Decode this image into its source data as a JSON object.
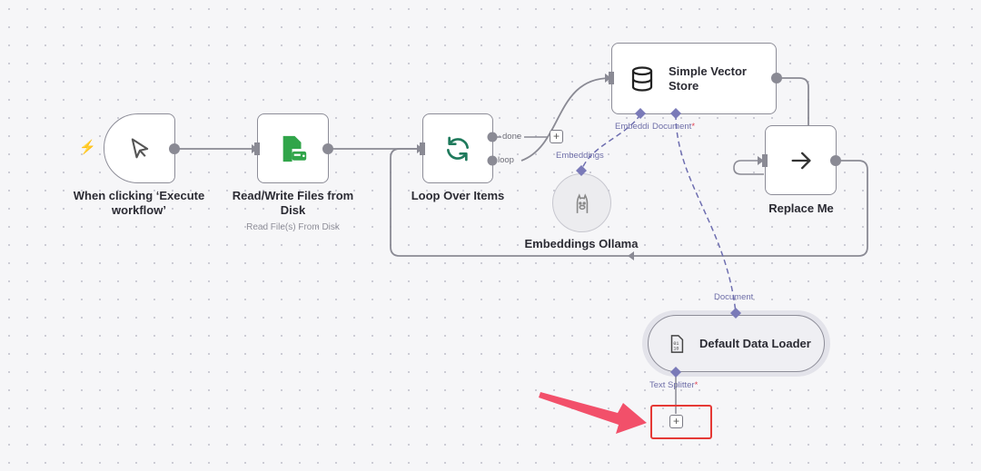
{
  "nodes": {
    "trigger": {
      "label": "When clicking ‘Execute workflow’",
      "icon": "cursor-icon"
    },
    "read_write": {
      "label": "Read/Write Files from Disk",
      "subtitle": "Read File(s) From Disk",
      "icon": "file-disk-icon"
    },
    "loop": {
      "label": "Loop Over Items",
      "icon": "loop-arrows-icon",
      "output_done": "done",
      "output_loop": "loop"
    },
    "vector_store": {
      "label_line1": "Simple Vector",
      "label_line2": "Store",
      "icon": "database-icon",
      "port_embedding": "Embeddi",
      "port_document": "Document",
      "required_mark": "*"
    },
    "replace_me": {
      "label": "Replace Me",
      "icon": "arrow-right-icon"
    },
    "embeddings": {
      "label": "Embeddings Ollama",
      "port_label": "Embeddings",
      "icon": "ollama-icon"
    },
    "data_loader": {
      "label": "Default Data Loader",
      "port_top": "Document",
      "port_bottom": "Text Splitter",
      "required_mark": "*",
      "icon": "binary-file-icon"
    }
  },
  "add_button": {
    "symbol": "+"
  },
  "colors": {
    "accent_trigger": "#f0653b",
    "green_icon": "#31a54a",
    "teal_icon": "#1f7a5c",
    "port_purple": "#7a7ab8",
    "highlight_red": "#e53935",
    "arrow_red": "#f2506a"
  }
}
